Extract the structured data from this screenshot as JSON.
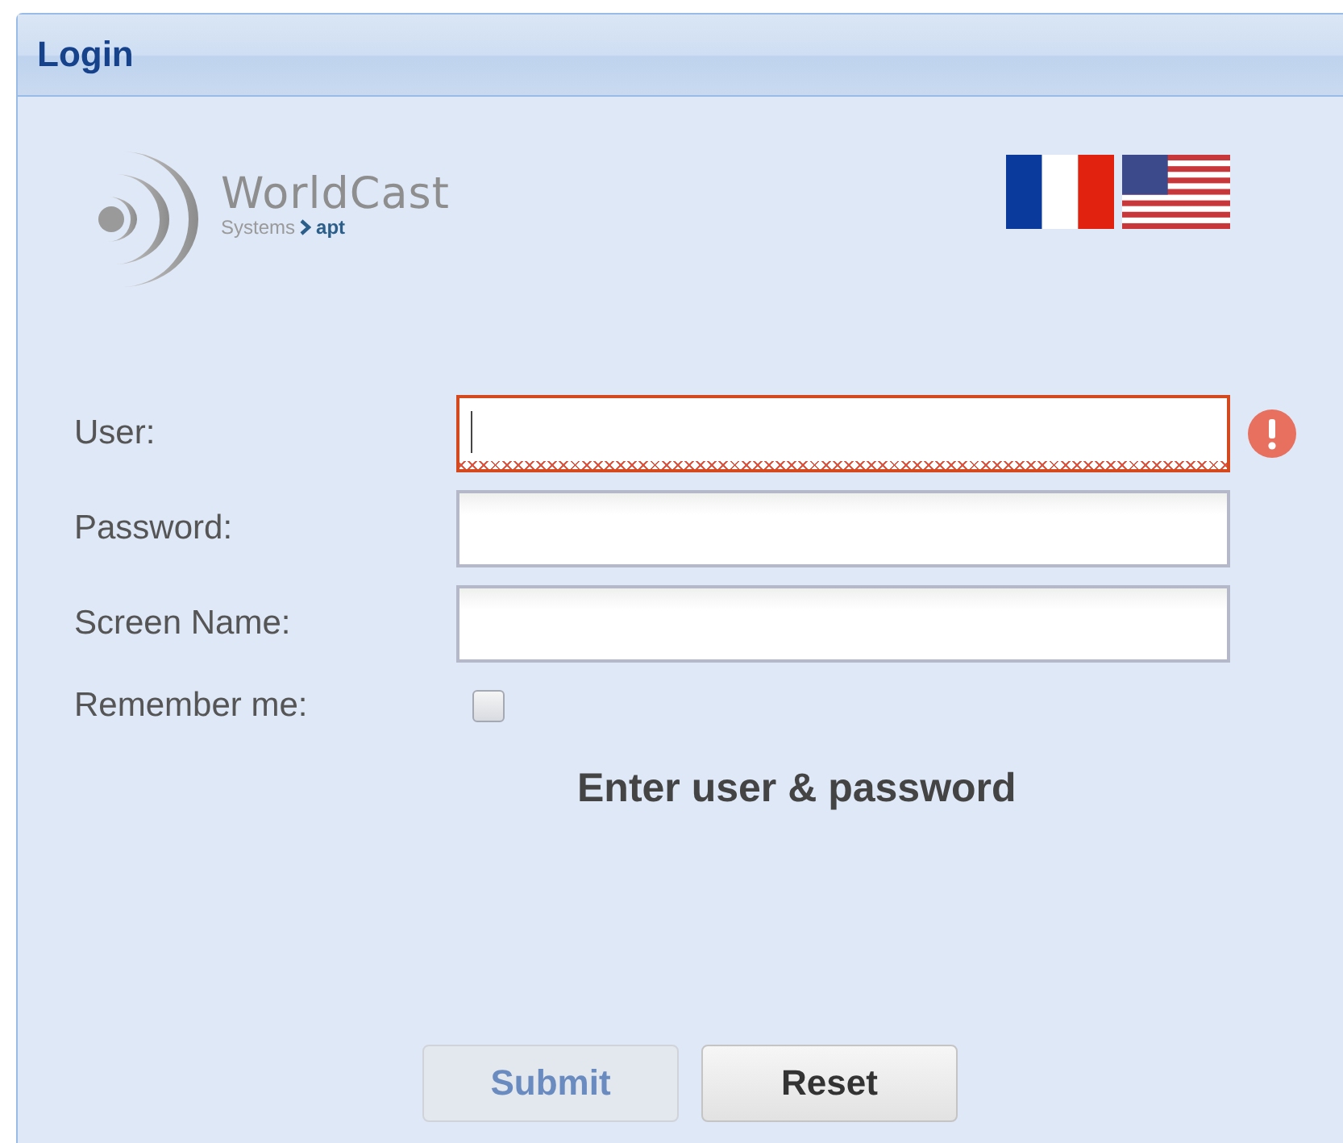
{
  "window": {
    "title": "Login"
  },
  "logo": {
    "name": "WorldCast",
    "tagline": "Systems",
    "product": "apt"
  },
  "languages": [
    {
      "kind": "fr"
    },
    {
      "kind": "us"
    }
  ],
  "fields": [
    {
      "kind": "text",
      "label": "User:",
      "invalid": true,
      "focused": true
    },
    {
      "kind": "text",
      "label": "Password:",
      "invalid": false,
      "focused": false
    },
    {
      "kind": "text",
      "label": "Screen Name:",
      "invalid": false,
      "focused": false
    },
    {
      "kind": "checkbox",
      "label": "Remember me:",
      "checked": false
    }
  ],
  "message": "Enter user & password",
  "buttons": [
    {
      "label": "Submit",
      "disabled": true
    },
    {
      "label": "Reset",
      "disabled": false
    }
  ]
}
